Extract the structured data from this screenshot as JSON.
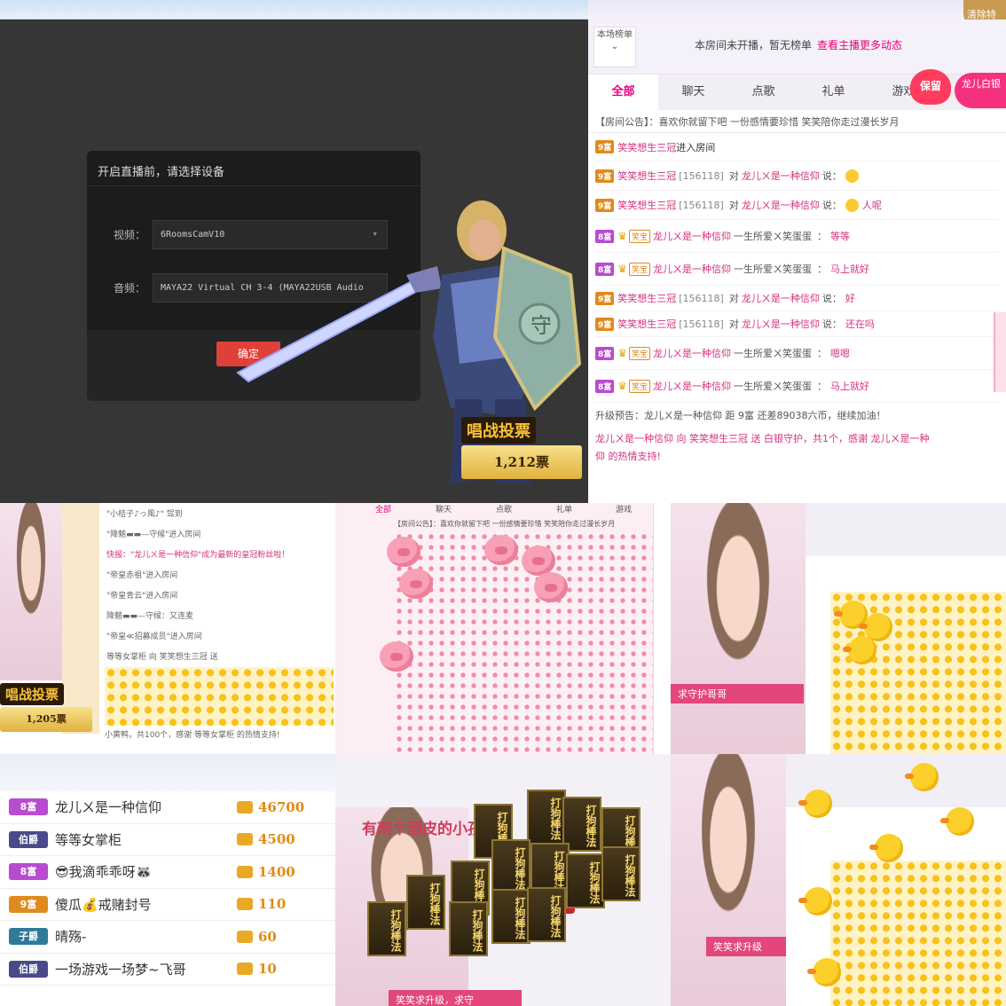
{
  "main": {
    "dialog": {
      "title": "开启直播前，请选择设备",
      "video_label": "视频：",
      "video_value": "6RoomsCamV10",
      "audio_label": "音频：",
      "audio_value": "MAYA22 Virtual CH 3-4 (MAYA22USB Audio",
      "confirm": "确定"
    },
    "vote": {
      "label": "唱战投票",
      "count": "1,212票"
    }
  },
  "chat": {
    "rank_tab": "本场榜单",
    "rank_msg": "本房间未开播，暂无榜单",
    "rank_more": "查看主播更多动态",
    "tabs": [
      "全部",
      "聊天",
      "点歌",
      "礼单",
      "游戏"
    ],
    "heart": "保留",
    "corner_badge": "清除特",
    "dragon_badge": "龙儿​白银",
    "notice": "【房间公告】：喜欢你就留下吧 一份感情要珍惜 笑笑陪你走过漫长岁月",
    "messages": [
      {
        "badge": "9富",
        "bclass": "b9",
        "name": "笑笑想生三冠",
        "text": "进入房间"
      },
      {
        "badge": "9富",
        "bclass": "b9",
        "name": "笑笑想生三冠",
        "id": "[156118]",
        "to": "对",
        "target": "龙儿ㄨ是一种信仰",
        "verb": "说：",
        "say": "",
        "emoji": true
      },
      {
        "badge": "9富",
        "bclass": "b9",
        "name": "笑笑想生三冠",
        "id": "[156118]",
        "to": "对",
        "target": "龙儿ㄨ是一种信仰",
        "verb": "说：",
        "say": "人呢",
        "emoji": true
      },
      {
        "badge": "8富",
        "bclass": "b8",
        "vip": "笑宝",
        "name": "龙儿ㄨ是一种信仰",
        "to": "一生所爱ㄨ笑蛋蛋",
        "verb": "：",
        "say": "等等"
      },
      {
        "badge": "8富",
        "bclass": "b8",
        "vip": "笑宝",
        "name": "龙儿ㄨ是一种信仰",
        "to": "一生所爱ㄨ笑蛋蛋",
        "verb": "：",
        "say": "马上就好"
      },
      {
        "badge": "9富",
        "bclass": "b9",
        "name": "笑笑想生三冠",
        "id": "[156118]",
        "to": "对",
        "target": "龙儿ㄨ是一种信仰",
        "verb": "说：",
        "say": "好"
      },
      {
        "badge": "9富",
        "bclass": "b9",
        "name": "笑笑想生三冠",
        "id": "[156118]",
        "to": "对",
        "target": "龙儿ㄨ是一种信仰",
        "verb": "说：",
        "say": "还在吗"
      },
      {
        "badge": "8富",
        "bclass": "b8",
        "vip": "笑宝",
        "name": "龙儿ㄨ是一种信仰",
        "to": "一生所爱ㄨ笑蛋蛋",
        "verb": "：",
        "say": "嗯嗯"
      },
      {
        "badge": "8富",
        "bclass": "b8",
        "vip": "笑宝",
        "name": "龙儿ㄨ是一种信仰",
        "to": "一生所爱ㄨ笑蛋蛋",
        "verb": "：",
        "say": "马上就好"
      }
    ],
    "upgrade": "升级预告：龙儿ㄨ是一种信仰 距 9富 还差89038六币，继续加油！",
    "gift_line1": "龙儿ㄨ是一种信仰 向 笑笑想生三冠 送 白银守护，共1个，感谢 龙儿ㄨ是一种",
    "gift_line2": "仰 的热情支持!"
  },
  "tile1": {
    "vote_label": "唱战投票",
    "vote_count": "1,205票",
    "lines": [
      "\"小桔子♪っ風♪\" 驾到",
      "\"降魈▬▬—守候\"进入房间",
      "快报：\"龙儿ㄨ是一种信仰\"成为最新的皇冠粉丝啦！",
      "\"帝皇赤祖\"进入房间",
      "\"帝皇青云\"进入房间",
      "降魈▬▬—守候：又连麦",
      "\"帝皇≪招募成员\"进入房间",
      "等等女掌柜 向 笑笑想生三冠 送"
    ],
    "footer": "小黄鸭，共100个，感谢 等等女掌柜 的热情支持!"
  },
  "tile2": {
    "tabs": [
      "全部",
      "聊天",
      "点歌",
      "礼单",
      "游戏"
    ],
    "notice": "【房间公告】：喜欢你就留下吧 一份感情要珍惜 笑笑陪你走过漫长岁月"
  },
  "tile3": {
    "bar": "求守护哥哥"
  },
  "ranklist": {
    "rows": [
      {
        "badge": "8富",
        "color": "#b84bd0",
        "name": "龙儿ㄨ是一种信仰",
        "value": "46700"
      },
      {
        "badge": "伯爵",
        "color": "#4a4a8a",
        "name": "等等女掌柜",
        "value": "4500"
      },
      {
        "badge": "8富",
        "color": "#b84bd0",
        "name": "😎我滴乖乖呀🦝",
        "value": "1400"
      },
      {
        "badge": "9富",
        "color": "#e08a1e",
        "name": "傻瓜💰戒赌封号",
        "value": "110"
      },
      {
        "badge": "子爵",
        "color": "#2f7a9a",
        "name": "晴殇-",
        "value": "60"
      },
      {
        "badge": "伯爵",
        "color": "#4a4a8a",
        "name": "一场游戏一场梦~飞哥",
        "value": "10"
      }
    ]
  },
  "tile5": {
    "caption": "有两个顽皮的小孩儿",
    "card_text": "打狗棒法",
    "bar": "笑笑求升级，求守"
  },
  "tile6": {
    "bar": "笑笑求升级"
  }
}
